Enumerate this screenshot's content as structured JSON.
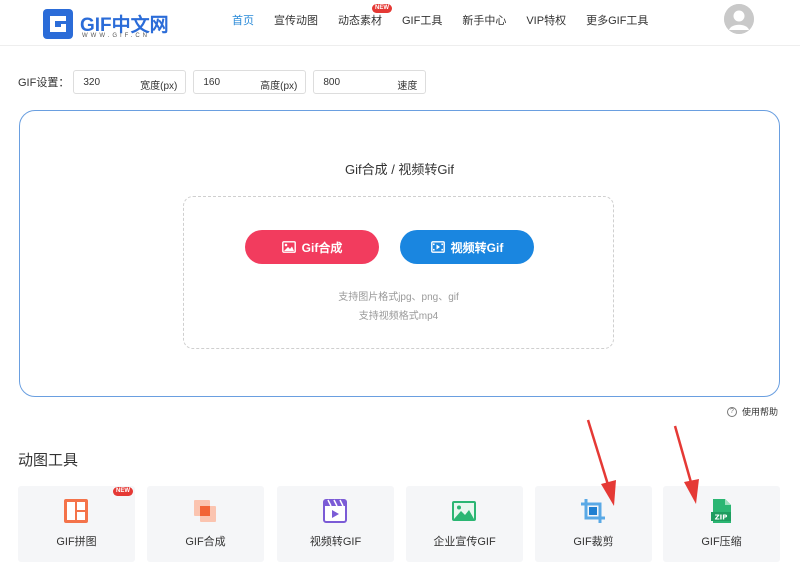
{
  "header": {
    "logo_text": "GIF中文网",
    "logo_sub": "WWW.GIF.CN",
    "nav": [
      {
        "label": "首页",
        "active": true
      },
      {
        "label": "宣传动图"
      },
      {
        "label": "动态素材",
        "badge": "NEW"
      },
      {
        "label": "GIF工具"
      },
      {
        "label": "新手中心"
      },
      {
        "label": "VIP特权"
      },
      {
        "label": "更多GIF工具"
      }
    ]
  },
  "settings": {
    "label": "GIF设置：",
    "fields": [
      {
        "value": "320",
        "unit": "宽度(px)"
      },
      {
        "value": "160",
        "unit": "高度(px)"
      },
      {
        "value": "800",
        "unit": "速度"
      }
    ]
  },
  "upload": {
    "title": "Gif合成 / 视频转Gif",
    "btn_gif": "Gif合成",
    "btn_video": "视频转Gif",
    "hint_image": "支持图片格式jpg、png、gif",
    "hint_video": "支持视频格式mp4"
  },
  "help": {
    "label": "使用帮助",
    "icon": "question-circle-icon"
  },
  "tools": {
    "title": "动图工具",
    "items": [
      {
        "label": "GIF拼图",
        "badge": "NEW",
        "icon": "collage-icon"
      },
      {
        "label": "GIF合成",
        "icon": "merge-icon"
      },
      {
        "label": "视频转GIF",
        "icon": "video-clapper-icon"
      },
      {
        "label": "企业宣传GIF",
        "icon": "landscape-image-icon"
      },
      {
        "label": "GIF裁剪",
        "icon": "crop-icon"
      },
      {
        "label": "GIF压缩",
        "icon": "zip-file-icon"
      }
    ]
  },
  "colors": {
    "accent": "#2a8ad8",
    "gif_button": "#f23c5e",
    "video_button": "#1a86e0",
    "badge": "#e53935",
    "arrow": "#e53935"
  }
}
